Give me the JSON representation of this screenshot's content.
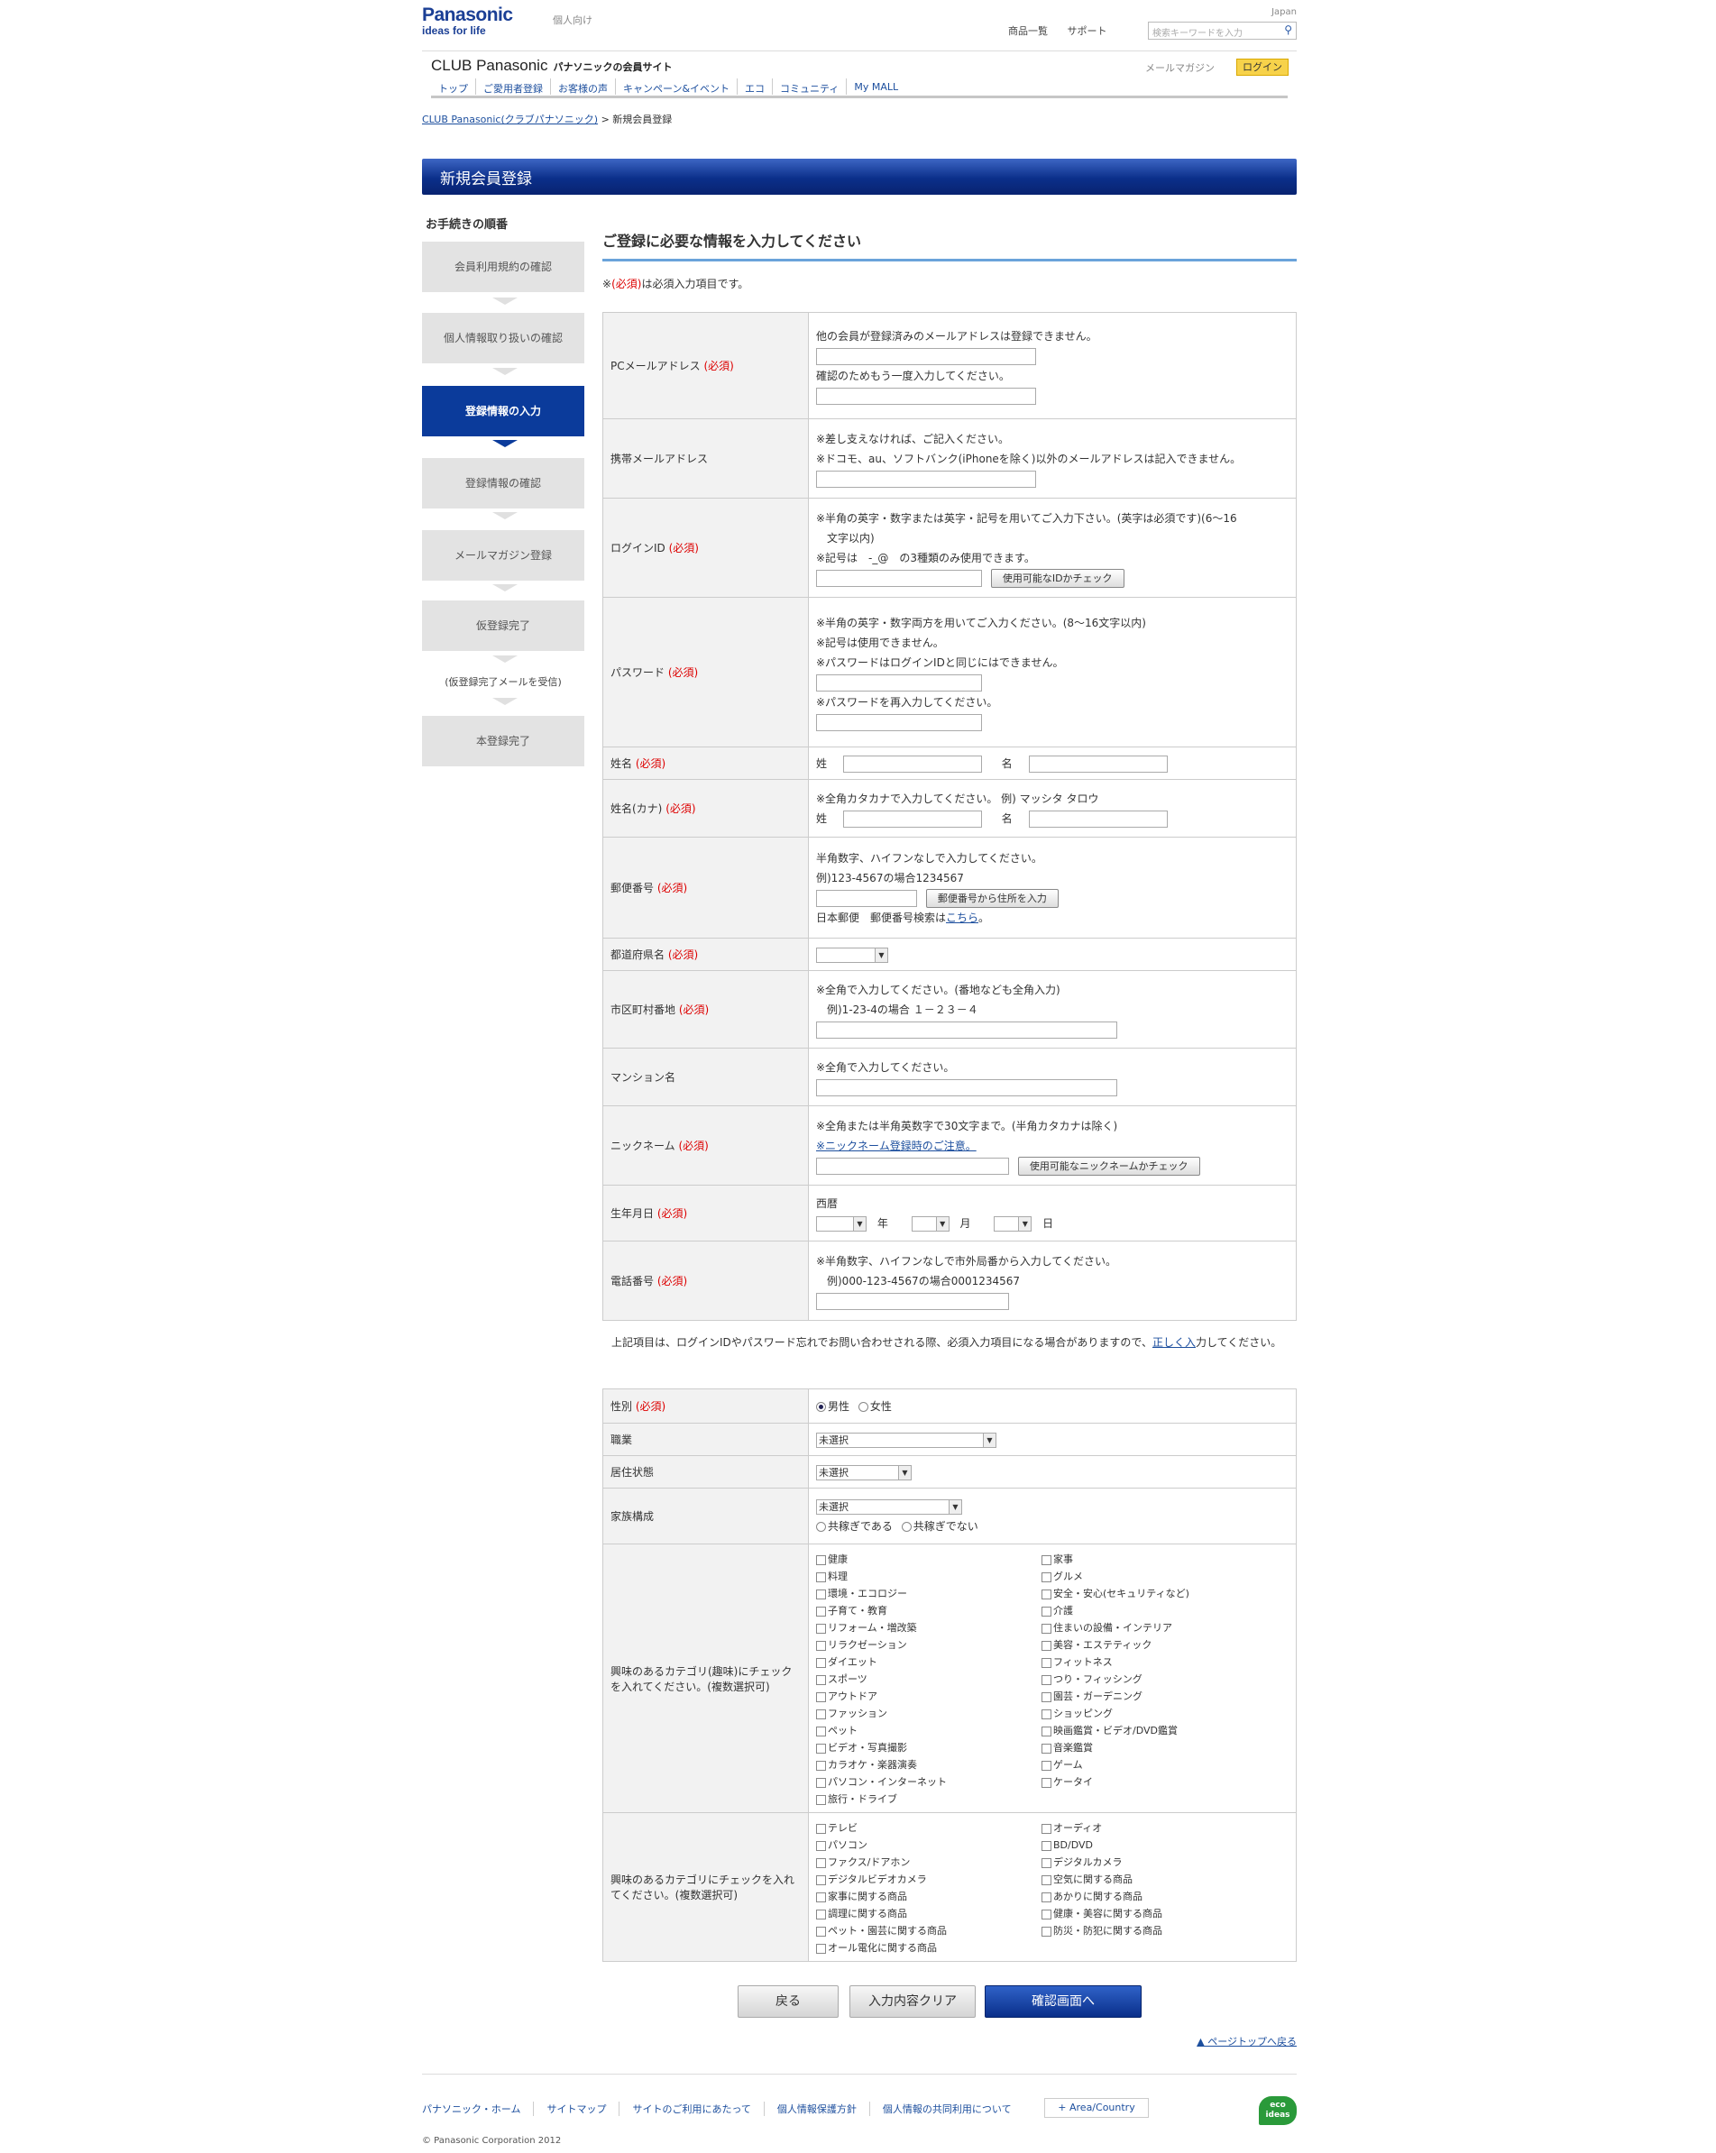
{
  "header": {
    "logo": "Panasonic",
    "tagline": "ideas for life",
    "personal": "個人向け",
    "region": "Japan",
    "nav": [
      "商品一覧",
      "サポート"
    ],
    "search_placeholder": "検索キーワードを入力"
  },
  "club": {
    "title": "CLUB Panasonic",
    "subtitle": "パナソニックの会員サイト",
    "mailmag": "メールマガジン",
    "login": "ログイン",
    "gnav": [
      "トップ",
      "ご愛用者登録",
      "お客様の声",
      "キャンペーン&イベント",
      "エコ",
      "コミュニティ",
      "My MALL"
    ]
  },
  "breadcrumb": {
    "home": "CLUB Panasonic(クラブパナソニック)",
    "sep": " > ",
    "current": "新規会員登録"
  },
  "page_title": "新規会員登録",
  "steps": {
    "title": "お手続きの順番",
    "items": [
      "会員利用規約の確認",
      "個人情報取り扱いの確認",
      "登録情報の入力",
      "登録情報の確認",
      "メールマガジン登録",
      "仮登録完了",
      "本登録完了"
    ],
    "note": "(仮登録完了メールを受信)"
  },
  "form": {
    "title": "ご登録に必要な情報を入力してください",
    "reqnote_pre": "※",
    "req": "(必須)",
    "reqnote_post": "は必須入力項目です。",
    "pcmail": {
      "label": "PCメールアドレス",
      "n1": "他の会員が登録済みのメールアドレスは登録できません。",
      "n2": "確認のためもう一度入力してください。"
    },
    "mobile": {
      "label": "携帯メールアドレス",
      "n1": "※差し支えなければ、ご記入ください。",
      "n2": "※ドコモ、au、ソフトバンク(iPhoneを除く)以外のメールアドレスは記入できません。"
    },
    "loginid": {
      "label": "ログインID",
      "n1": "※半角の英字・数字または英字・記号を用いてご入力下さい。(英字は必須です)(6〜16",
      "n1b": "文字以内)",
      "n2": "※記号は　-_@　の3種類のみ使用できます。",
      "btn": "使用可能なIDかチェック"
    },
    "password": {
      "label": "パスワード",
      "n1": "※半角の英字・数字両方を用いてご入力ください。(8〜16文字以内)",
      "n2": "※記号は使用できません。",
      "n3": "※パスワードはログインIDと同じにはできません。",
      "n4": "※パスワードを再入力してください。"
    },
    "name": {
      "label": "姓名",
      "sei": "姓",
      "mei": "名"
    },
    "kana": {
      "label": "姓名(カナ)",
      "n1": "※全角カタカナで入力してください。 例) マッシタ タロウ",
      "sei": "姓",
      "mei": "名"
    },
    "zip": {
      "label": "郵便番号",
      "n1": "半角数字、ハイフンなしで入力してください。",
      "n2": "例)123-4567の場合1234567",
      "btn": "郵便番号から住所を入力",
      "n3": "日本郵便　郵便番号検索は",
      "link": "こちら",
      "n3b": "。"
    },
    "pref": {
      "label": "都道府県名"
    },
    "city": {
      "label": "市区町村番地",
      "n1": "※全角で入力してください。(番地なども全角入力)",
      "n2": "　例)1-23-4の場合 １－２３－４"
    },
    "mansion": {
      "label": "マンション名",
      "n1": "※全角で入力してください。"
    },
    "nick": {
      "label": "ニックネーム",
      "n1": "※全角または半角英数字で30文字まで。(半角カタカナは除く)",
      "link": "※ニックネーム登録時のご注意。",
      "btn": "使用可能なニックネームかチェック"
    },
    "birth": {
      "label": "生年月日",
      "era": "西暦",
      "y": "年",
      "m": "月",
      "d": "日"
    },
    "tel": {
      "label": "電話番号",
      "n1": "※半角数字、ハイフンなしで市外局番から入力してください。",
      "n2": "　例)000-123-4567の場合0001234567"
    }
  },
  "midnote": {
    "text": "上記項目は、ログインIDやパスワード忘れでお問い合わせされる際、必須入力項目になる場合がありますので、",
    "link": "正しく入",
    "text2": "力してください。"
  },
  "form2": {
    "gender": {
      "label": "性別",
      "male": "男性",
      "female": "女性"
    },
    "job": {
      "label": "職業",
      "value": "未選択"
    },
    "living": {
      "label": "居住状態",
      "value": "未選択"
    },
    "family": {
      "label": "家族構成",
      "value": "未選択",
      "r1": "共稼ぎである",
      "r2": "共稼ぎでない"
    },
    "hobby": {
      "label": "興味のあるカテゴリ(趣味)にチェックを入れてください。(複数選択可)",
      "left": [
        "健康",
        "料理",
        "環境・エコロジー",
        "子育て・教育",
        "リフォーム・増改築",
        "リラクゼーション",
        "ダイエット",
        "スポーツ",
        "アウトドア",
        "ファッション",
        "ペット",
        "ビデオ・写真撮影",
        "カラオケ・楽器演奏",
        "パソコン・インターネット",
        "旅行・ドライブ"
      ],
      "right": [
        "家事",
        "グルメ",
        "安全・安心(セキュリティなど)",
        "介護",
        "住まいの設備・インテリア",
        "美容・エステティック",
        "フィットネス",
        "つり・フィッシング",
        "園芸・ガーデニング",
        "ショッピング",
        "映画鑑賞・ビデオ/DVD鑑賞",
        "音楽鑑賞",
        "ゲーム",
        "ケータイ"
      ]
    },
    "product": {
      "label": "興味のあるカテゴリにチェックを入れてください。(複数選択可)",
      "left": [
        "テレビ",
        "パソコン",
        "ファクス/ドアホン",
        "デジタルビデオカメラ",
        "家事に関する商品",
        "調理に関する商品",
        "ペット・園芸に関する商品",
        "オール電化に関する商品"
      ],
      "right": [
        "オーディオ",
        "BD/DVD",
        "デジタルカメラ",
        "空気に関する商品",
        "あかりに関する商品",
        "健康・美容に関する商品",
        "防災・防犯に関する商品"
      ]
    }
  },
  "buttons": {
    "back": "戻る",
    "clear": "入力内容クリア",
    "confirm": "確認画面へ"
  },
  "pagetop": "▲ ページトップへ戻る",
  "footer": {
    "links": [
      "パナソニック・ホーム",
      "サイトマップ",
      "サイトのご利用にあたって",
      "個人情報保護方針",
      "個人情報の共同利用について"
    ],
    "area": "+ Area/Country",
    "eco": "eco ideas",
    "copyright": "© Panasonic Corporation 2012"
  }
}
